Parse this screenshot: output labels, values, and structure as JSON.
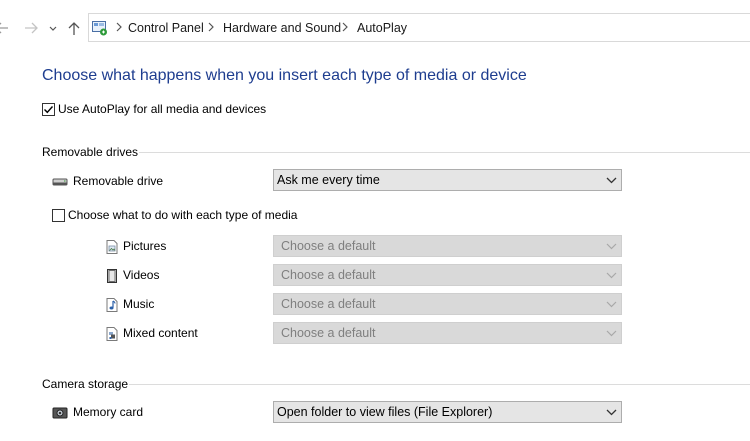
{
  "breadcrumb": [
    "Control Panel",
    "Hardware and Sound",
    "AutoPlay"
  ],
  "page_title": "Choose what happens when you insert each type of media or device",
  "use_autoplay": {
    "label": "Use AutoPlay for all media and devices",
    "checked": true
  },
  "removable_drives": {
    "group_label": "Removable drives",
    "drive": {
      "label": "Removable drive",
      "icon": "removable-drive-icon",
      "value": "Ask me every time"
    },
    "per_media": {
      "label": "Choose what to do with each type of media",
      "checked": false
    },
    "media": [
      {
        "label": "Pictures",
        "icon": "pictures-icon",
        "value": "Choose a default"
      },
      {
        "label": "Videos",
        "icon": "videos-icon",
        "value": "Choose a default"
      },
      {
        "label": "Music",
        "icon": "music-icon",
        "value": "Choose a default"
      },
      {
        "label": "Mixed content",
        "icon": "mixed-content-icon",
        "value": "Choose a default"
      }
    ]
  },
  "camera_storage": {
    "group_label": "Camera storage",
    "memory_card": {
      "label": "Memory card",
      "icon": "memory-card-icon",
      "value": "Open folder to view files (File Explorer)"
    }
  },
  "colors": {
    "title": "#1e3d8f",
    "dropdown_bg": "#e5e5e5",
    "disabled_text": "#7f7f7f"
  }
}
